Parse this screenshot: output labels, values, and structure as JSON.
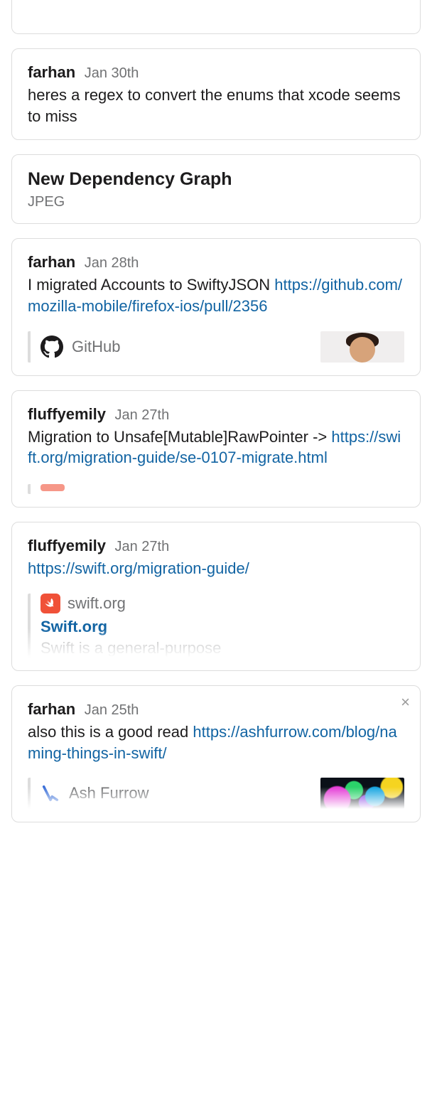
{
  "cards": [
    {
      "author": "farhan",
      "date": "Jan 30th",
      "text": "heres a regex to convert the enums that xcode seems to miss"
    },
    {
      "file_title": "New Dependency Graph",
      "file_type": "JPEG"
    },
    {
      "author": "farhan",
      "date": "Jan 28th",
      "text": "I migrated Accounts to SwiftyJSON ",
      "link": "https://github.com/mozilla-mobile/firefox-ios/pull/2356",
      "attachment_name": "GitHub"
    },
    {
      "author": "fluffyemily",
      "date": "Jan 27th",
      "text": "Migration to Unsafe[Mutable]RawPointer -> ",
      "link": "https://swift.org/migration-guide/se-0107-migrate.html"
    },
    {
      "author": "fluffyemily",
      "date": "Jan 27th",
      "link": "https://swift.org/migration-guide/",
      "unfurl": {
        "site": "swift.org",
        "title": "Swift.org",
        "desc": "Swift is a general-purpose"
      }
    },
    {
      "author": "farhan",
      "date": "Jan 25th",
      "text": "also this is a good read ",
      "link": "https://ashfurrow.com/blog/naming-things-in-swift/",
      "attachment_name": "Ash Furrow",
      "close_label": "×"
    }
  ]
}
